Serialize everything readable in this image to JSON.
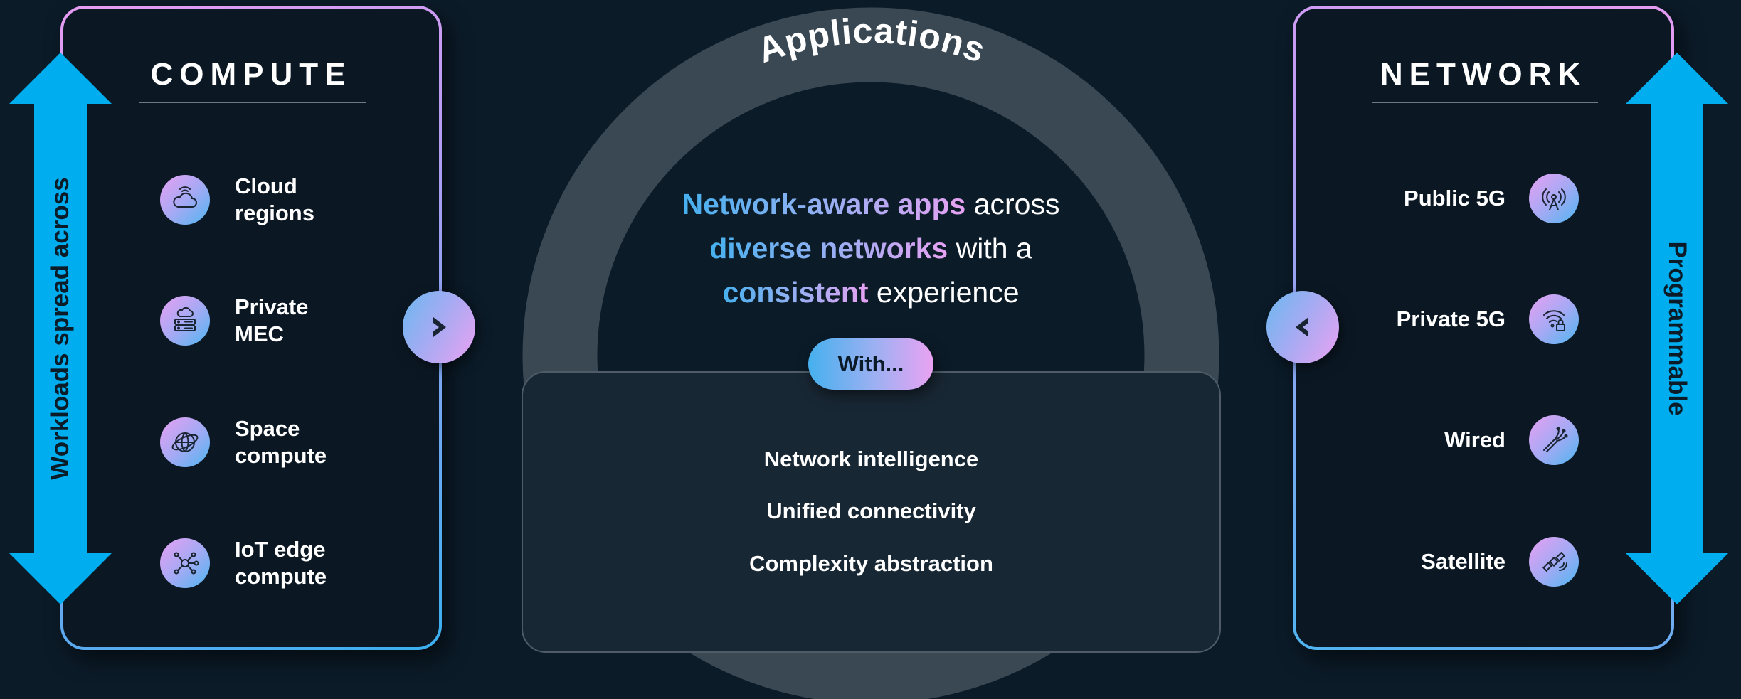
{
  "center": {
    "arc_title": "Applications",
    "headline_1_grad": "Network-aware apps",
    "headline_1_rest": " across",
    "headline_2_grad": "diverse networks",
    "headline_2_rest": " with a",
    "headline_3_grad": "consistent",
    "headline_3_rest": " experience",
    "with_label": "With...",
    "features": [
      "Network intelligence",
      "Unified connectivity",
      "Complexity abstraction"
    ]
  },
  "compute": {
    "title": "COMPUTE",
    "arrow_label": "Workloads spread across",
    "items": [
      {
        "label": "Cloud\nregions",
        "icon": "cloud-signal-icon"
      },
      {
        "label": "Private\nMEC",
        "icon": "cloud-server-icon"
      },
      {
        "label": "Space\ncompute",
        "icon": "globe-satellite-icon"
      },
      {
        "label": "IoT edge\ncompute",
        "icon": "hub-network-icon"
      }
    ]
  },
  "network": {
    "title": "NETWORK",
    "arrow_label": "Programmable",
    "items": [
      {
        "label": "Public 5G",
        "icon": "cell-tower-icon"
      },
      {
        "label": "Private 5G",
        "icon": "wifi-lock-icon"
      },
      {
        "label": "Wired",
        "icon": "fiber-cable-icon"
      },
      {
        "label": "Satellite",
        "icon": "satellite-icon"
      }
    ]
  },
  "colors": {
    "background": "#0b1b28",
    "arrow_blue": "#00adef",
    "gradient_pink": "#e7a2f2",
    "gradient_blue": "#46b0ee",
    "ring": "#3a4853"
  }
}
